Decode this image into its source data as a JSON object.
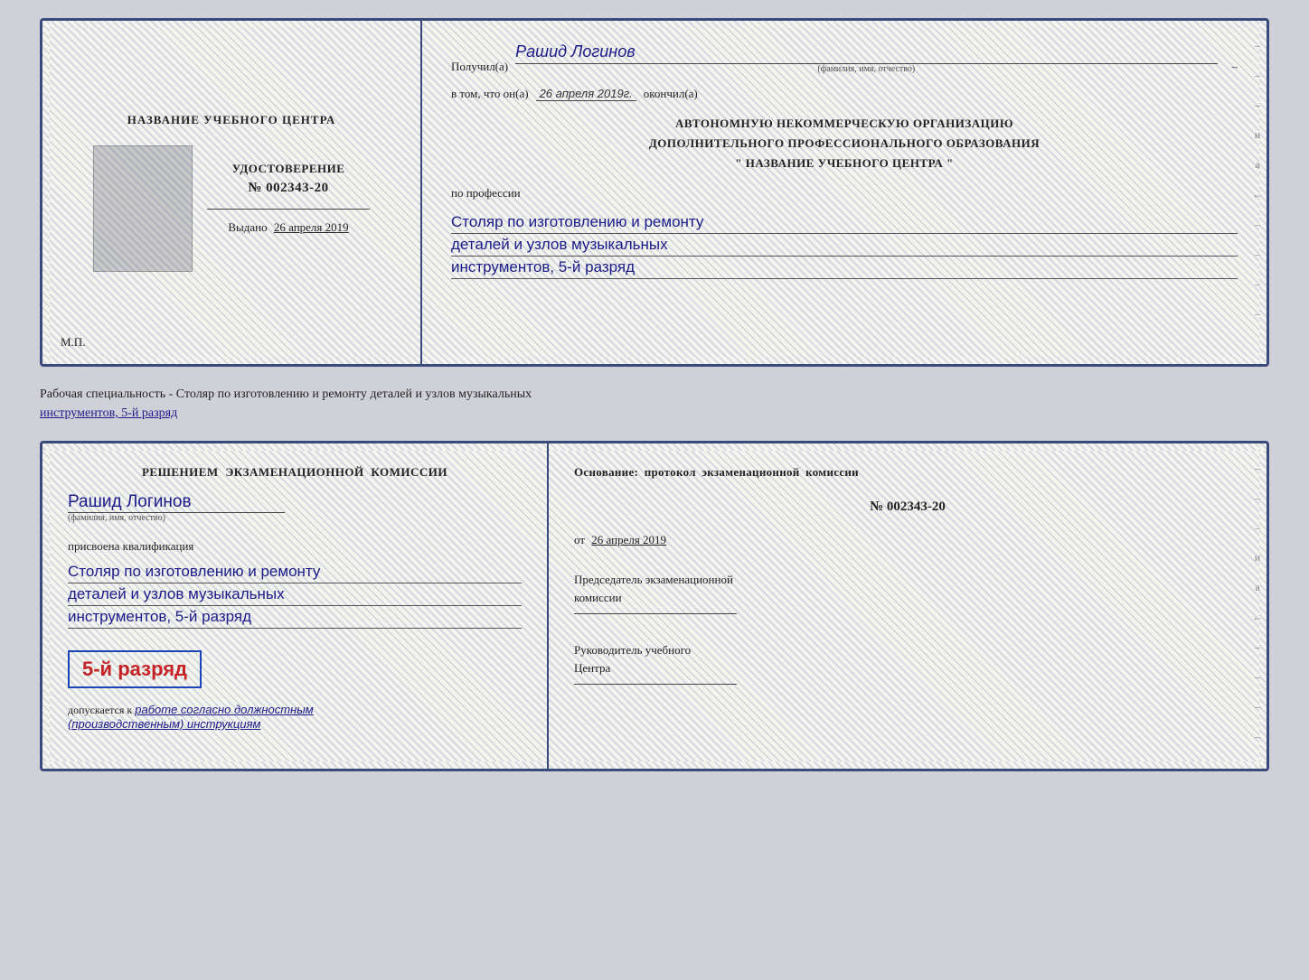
{
  "top_card": {
    "left": {
      "center_title": "НАЗВАНИЕ УЧЕБНОГО ЦЕНТРА",
      "cert_label": "УДОСТОВЕРЕНИЕ",
      "cert_number": "№ 002343-20",
      "issued_label": "Выдано",
      "issued_date": "26 апреля 2019",
      "mp_label": "М.П."
    },
    "right": {
      "received_label": "Получил(а)",
      "recipient_name": "Рашид Логинов",
      "name_sub_label": "(фамилия, имя, отчество)",
      "completed_label": "в том, что он(а)",
      "completed_date": "26 апреля 2019г.",
      "completed_suffix": "окончил(а)",
      "org_line1": "АВТОНОМНУЮ НЕКОММЕРЧЕСКУЮ ОРГАНИЗАЦИЮ",
      "org_line2": "ДОПОЛНИТЕЛЬНОГО ПРОФЕССИОНАЛЬНОГО ОБРАЗОВАНИЯ",
      "org_line3": "\"   НАЗВАНИЕ УЧЕБНОГО ЦЕНТРА   \"",
      "profession_label": "по профессии",
      "profession_line1": "Столяр по изготовлению и ремонту",
      "profession_line2": "деталей и узлов музыкальных",
      "profession_line3": "инструментов, 5-й разряд"
    }
  },
  "specialty_caption": {
    "text": "Рабочая специальность - Столяр по изготовлению и ремонту деталей и узлов музыкальных",
    "text2": "инструментов, 5-й разряд"
  },
  "bottom_card": {
    "left": {
      "decision_text": "Решением экзаменационной комиссии",
      "person_name": "Рашид Логинов",
      "name_sub_label": "(фамилия, имя, отчество)",
      "assigned_label": "присвоена квалификация",
      "qual_line1": "Столяр по изготовлению и ремонту",
      "qual_line2": "деталей и узлов музыкальных",
      "qual_line3": "инструментов, 5-й разряд",
      "stamp_text": "5-й разряд",
      "allowed_prefix": "допускается к",
      "allowed_text": "работе согласно должностным",
      "allowed_text2": "(производственным) инструкциям"
    },
    "right": {
      "basis_label": "Основание: протокол экзаменационной комиссии",
      "protocol_number": "№  002343-20",
      "from_label": "от",
      "from_date": "26 апреля 2019",
      "chairman_label": "Председатель экзаменационной",
      "chairman_label2": "комиссии",
      "director_label": "Руководитель учебного",
      "director_label2": "Центра"
    }
  },
  "margin_dashes": [
    "–",
    "–",
    "–",
    "и",
    "а",
    "←",
    "–",
    "–",
    "–",
    "–"
  ]
}
